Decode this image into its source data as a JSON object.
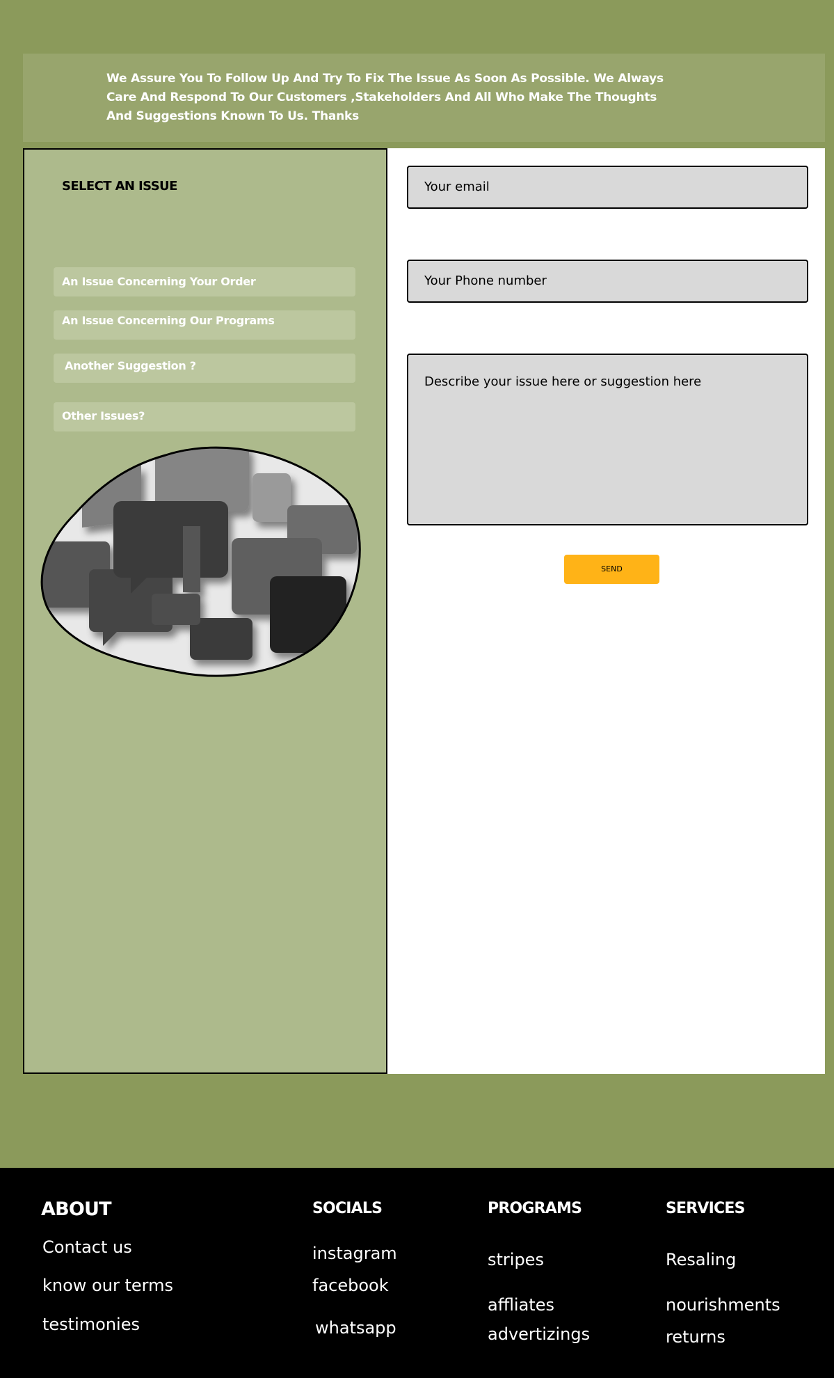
{
  "banner": {
    "message": "We  Assure You To Follow Up And Try To Fix The Issue As Soon As Possible. We Always Care And Respond To Our Customers ,Stakeholders And All Who Make The Thoughts And Suggestions Known To Us. Thanks"
  },
  "issues": {
    "heading": "SELECT AN ISSUE",
    "items": [
      {
        "label": "An  Issue Concerning Your Order"
      },
      {
        "label": "An  Issue Concerning Our Programs"
      },
      {
        "label": "Another Suggestion ?"
      },
      {
        "label": "Other Issues?"
      }
    ]
  },
  "form": {
    "email_placeholder": "Your email",
    "phone_placeholder": "Your Phone number",
    "message_placeholder": "Describe your issue  here or suggestion here",
    "send_label": "SEND"
  },
  "footer": {
    "about": {
      "title": "ABOUT",
      "links": [
        "Contact us",
        "know our terms",
        "testimonies"
      ]
    },
    "socials": {
      "title": "SOCIALS",
      "links": [
        "instagram",
        "facebook",
        "whatsapp"
      ]
    },
    "programs": {
      "title": "PROGRAMS",
      "links": [
        "stripes",
        "affliates",
        "advertizings"
      ]
    },
    "services": {
      "title": "SERVICES",
      "links": [
        "Resaling",
        "nourishments",
        "returns"
      ]
    }
  },
  "colors": {
    "page_bg": "#8b9a5b",
    "banner_bg": "#98a56d",
    "panel_bg": "#adba8c",
    "button_bg": "#bcc79f",
    "input_bg": "#d9d9d9",
    "send_bg": "#ffb317",
    "footer_bg": "#000000"
  }
}
